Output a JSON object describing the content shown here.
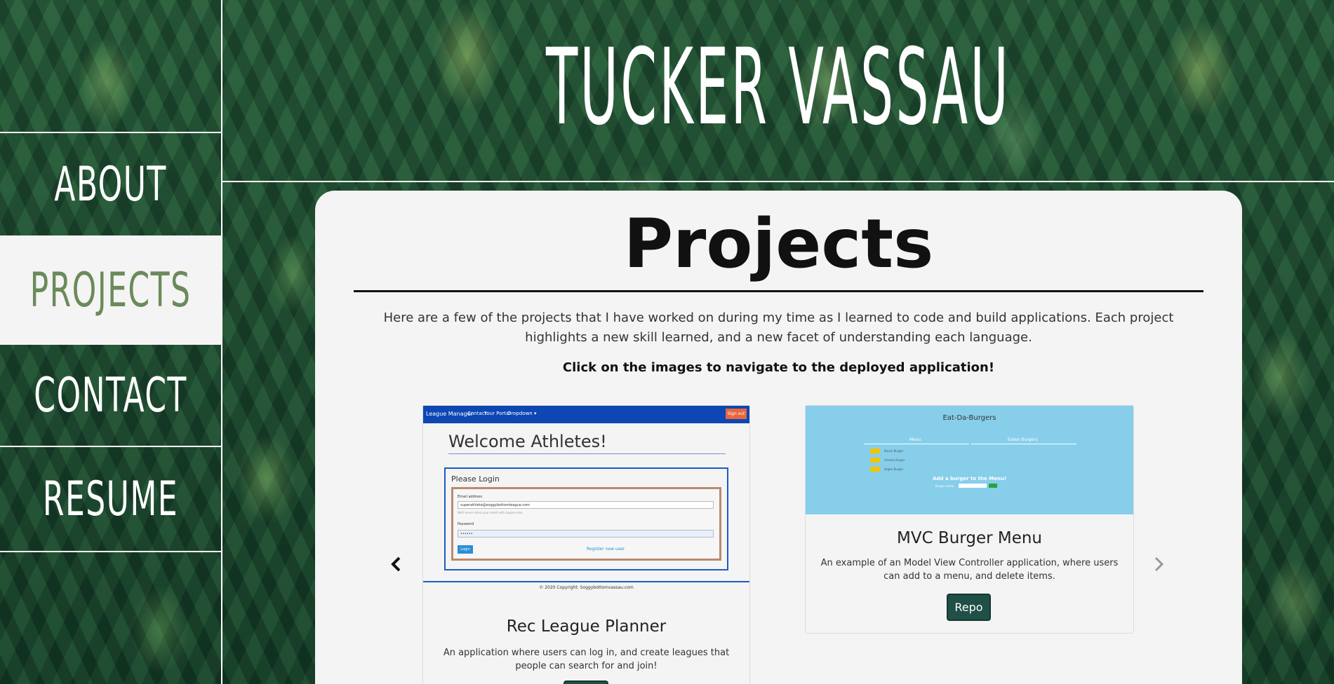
{
  "header": {
    "title": "Tucker Vassau"
  },
  "sidebar": {
    "items": [
      {
        "label": "About"
      },
      {
        "label": "Projects"
      },
      {
        "label": "Contact"
      },
      {
        "label": "Resume"
      }
    ]
  },
  "main": {
    "title": "Projects",
    "intro": "Here are a few of the projects that I have worked on during my time as I learned to code and build applications. Each project highlights a new skill learned, and a new facet of understanding each language.",
    "cta": "Click on the images to navigate to the deployed application!",
    "carousel": {
      "prev_icon": "chevron-left-icon",
      "next_icon": "chevron-right-icon",
      "cards": [
        {
          "title": "Rec League Planner",
          "description": "An application where users can log in, and create leagues that people can search for and join!",
          "screenshot": {
            "brand": "League Manager",
            "nav": [
              "Contact",
              "Your Portal",
              "Dropdown ▾"
            ],
            "signout": "Sign out",
            "welcome": "Welcome Athletes!",
            "login_title": "Please Login",
            "email_label": "Email address",
            "email_value": "superathlete@soggybottomleague.com",
            "email_help": "We'll never share your email with anyone else.",
            "password_label": "Password",
            "password_value": "••••••",
            "login_btn": "Login",
            "register_link": "Register new user",
            "footer": "© 2020 Copyright: Soggybottomvassau.com"
          }
        },
        {
          "title": "MVC Burger Menu",
          "description": "An example of an Model View Controller application, where users can add to a menu, and delete items.",
          "button": "Repo",
          "screenshot": {
            "title": "Eat-Da-Burgers",
            "col_menu": "Menu",
            "col_eaten": "Eaten Burgers",
            "items": [
              "Bacon Burger",
              "Cheese Burger",
              "Vegan Burger"
            ],
            "add_label": "Add a burger to the Menu!",
            "form_label": "Burger name:"
          }
        }
      ]
    }
  },
  "colors": {
    "panel_bg": "#f4f4f4",
    "active_nav_text": "#6b8a5a",
    "repo_button": "#1f4f46",
    "league_nav": "#0d47b3",
    "burger_bg": "#87ceeb"
  }
}
